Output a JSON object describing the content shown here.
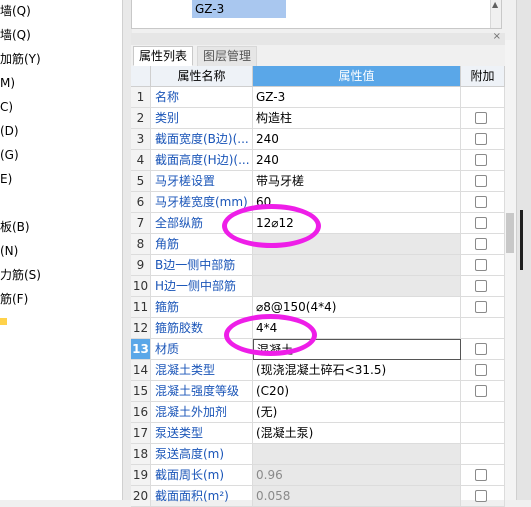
{
  "left_tree": {
    "items": [
      "墙(Q)",
      "墙(Q)",
      "加筋(Y)",
      "M)",
      "C)",
      "(D)",
      "(G)",
      "E)",
      "板(B)",
      "(N)",
      "力筋(S)",
      "筋(F)"
    ]
  },
  "top_panel": {
    "selected_item": "GZ-3",
    "scroll_up_icon": "triangle-up-icon"
  },
  "panel": {
    "close_label": "×"
  },
  "tabs": {
    "properties": "属性列表",
    "layers": "图层管理"
  },
  "grid": {
    "header": {
      "name": "属性名称",
      "value": "属性值",
      "extra": "附加"
    },
    "rows": [
      {
        "num": "1",
        "name": "名称",
        "value": "GZ-3",
        "checkbox": false
      },
      {
        "num": "2",
        "name": "类别",
        "value": "构造柱",
        "checkbox": true
      },
      {
        "num": "3",
        "name": "截面宽度(B边)(...",
        "value": "240",
        "checkbox": true
      },
      {
        "num": "4",
        "name": "截面高度(H边)(...",
        "value": "240",
        "checkbox": true
      },
      {
        "num": "5",
        "name": "马牙槎设置",
        "value": "带马牙槎",
        "checkbox": true
      },
      {
        "num": "6",
        "name": "马牙槎宽度(mm)",
        "value": "60",
        "checkbox": true
      },
      {
        "num": "7",
        "name": "全部纵筋",
        "value": "12⌀12",
        "checkbox": true
      },
      {
        "num": "8",
        "name": "角筋",
        "value": "",
        "checkbox": true
      },
      {
        "num": "9",
        "name": "B边一侧中部筋",
        "value": "",
        "checkbox": true
      },
      {
        "num": "10",
        "name": "H边一侧中部筋",
        "value": "",
        "checkbox": true
      },
      {
        "num": "11",
        "name": "箍筋",
        "value": "⌀8@150(4*4)",
        "checkbox": true
      },
      {
        "num": "12",
        "name": "箍筋胶数",
        "value": "4*4",
        "checkbox": false
      },
      {
        "num": "13",
        "name": "材质",
        "value": "混凝土",
        "checkbox": true
      },
      {
        "num": "14",
        "name": "混凝土类型",
        "value": "(现浇混凝土碎石<31.5)",
        "checkbox": true
      },
      {
        "num": "15",
        "name": "混凝土强度等级",
        "value": "(C20)",
        "checkbox": true
      },
      {
        "num": "16",
        "name": "混凝土外加剂",
        "value": "(无)",
        "checkbox": false
      },
      {
        "num": "17",
        "name": "泵送类型",
        "value": "(混凝土泵)",
        "checkbox": false
      },
      {
        "num": "18",
        "name": "泵送高度(m)",
        "value": "",
        "checkbox": false
      },
      {
        "num": "19",
        "name": "截面周长(m)",
        "value": "0.96",
        "checkbox": true
      },
      {
        "num": "20",
        "name": "截面面积(m²)",
        "value": "0.058",
        "checkbox": true
      }
    ]
  },
  "colors": {
    "header_accent": "#5aa7e8",
    "annotation": "#ee1ee8",
    "property_name": "#1a55b8"
  }
}
